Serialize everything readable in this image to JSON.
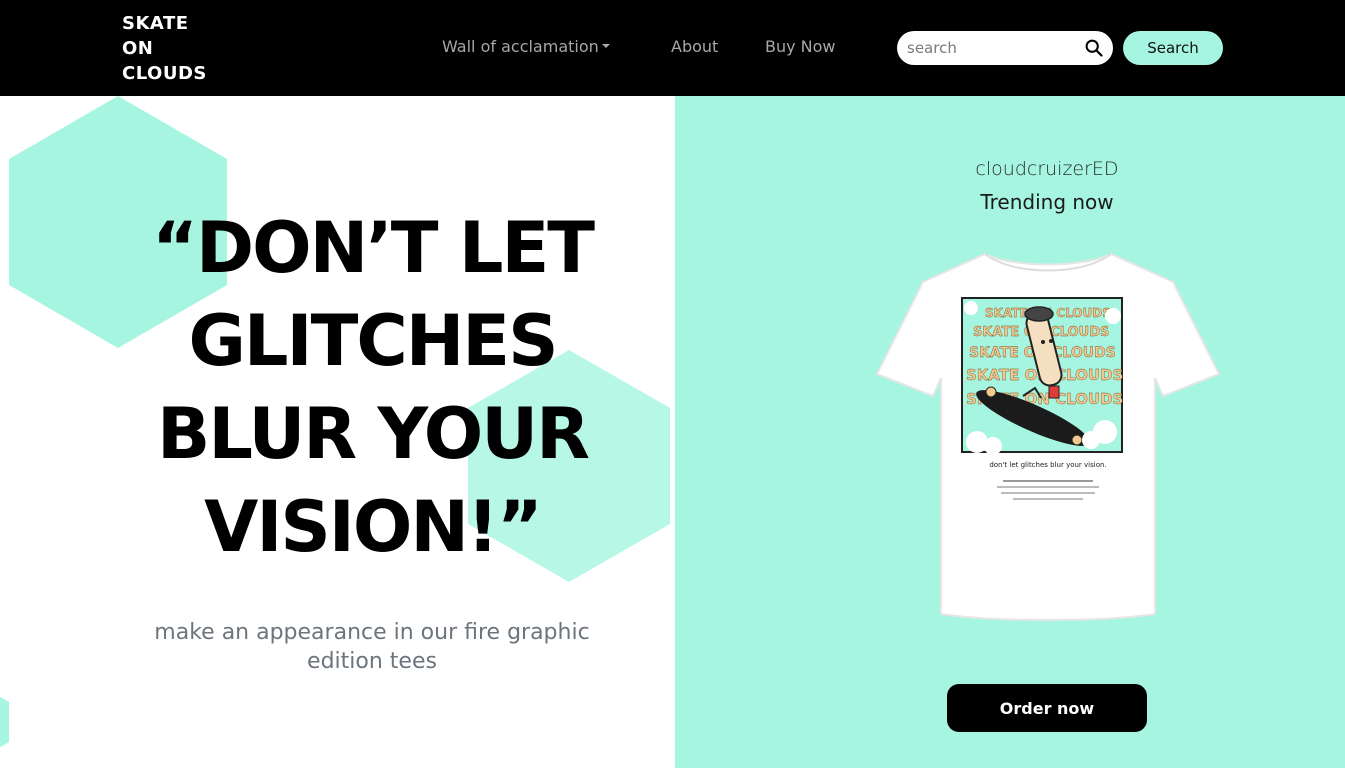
{
  "navbar": {
    "logo_lines": [
      "SKATE",
      "ON",
      "CLOUDS"
    ],
    "links": {
      "wall": "Wall of acclamation",
      "about": "About",
      "buy": "Buy Now"
    },
    "search": {
      "placeholder": "search",
      "value": "",
      "button_label": "Search"
    },
    "icons": {
      "search": "search-icon",
      "dropdown": "chevron-down-icon"
    }
  },
  "hero": {
    "quote_lines": [
      "“DON’T LET",
      "GLITCHES",
      "BLUR YOUR",
      "VISION!”"
    ],
    "subtitle": "make an appearance in our fire graphic edition tees"
  },
  "product": {
    "brand": "cloudcruizerED",
    "label": "Trending now",
    "order_label": "Order now",
    "tee_print": {
      "repeat_text": "SKATE ON CLOUDS",
      "tagline": "don't let glitches blur your vision."
    }
  },
  "colors": {
    "navbar_bg": "#000000",
    "accent": "#a6f5e0",
    "text_dark": "#000000",
    "muted": "#6c757d",
    "nav_link": "#a7a7a7"
  }
}
